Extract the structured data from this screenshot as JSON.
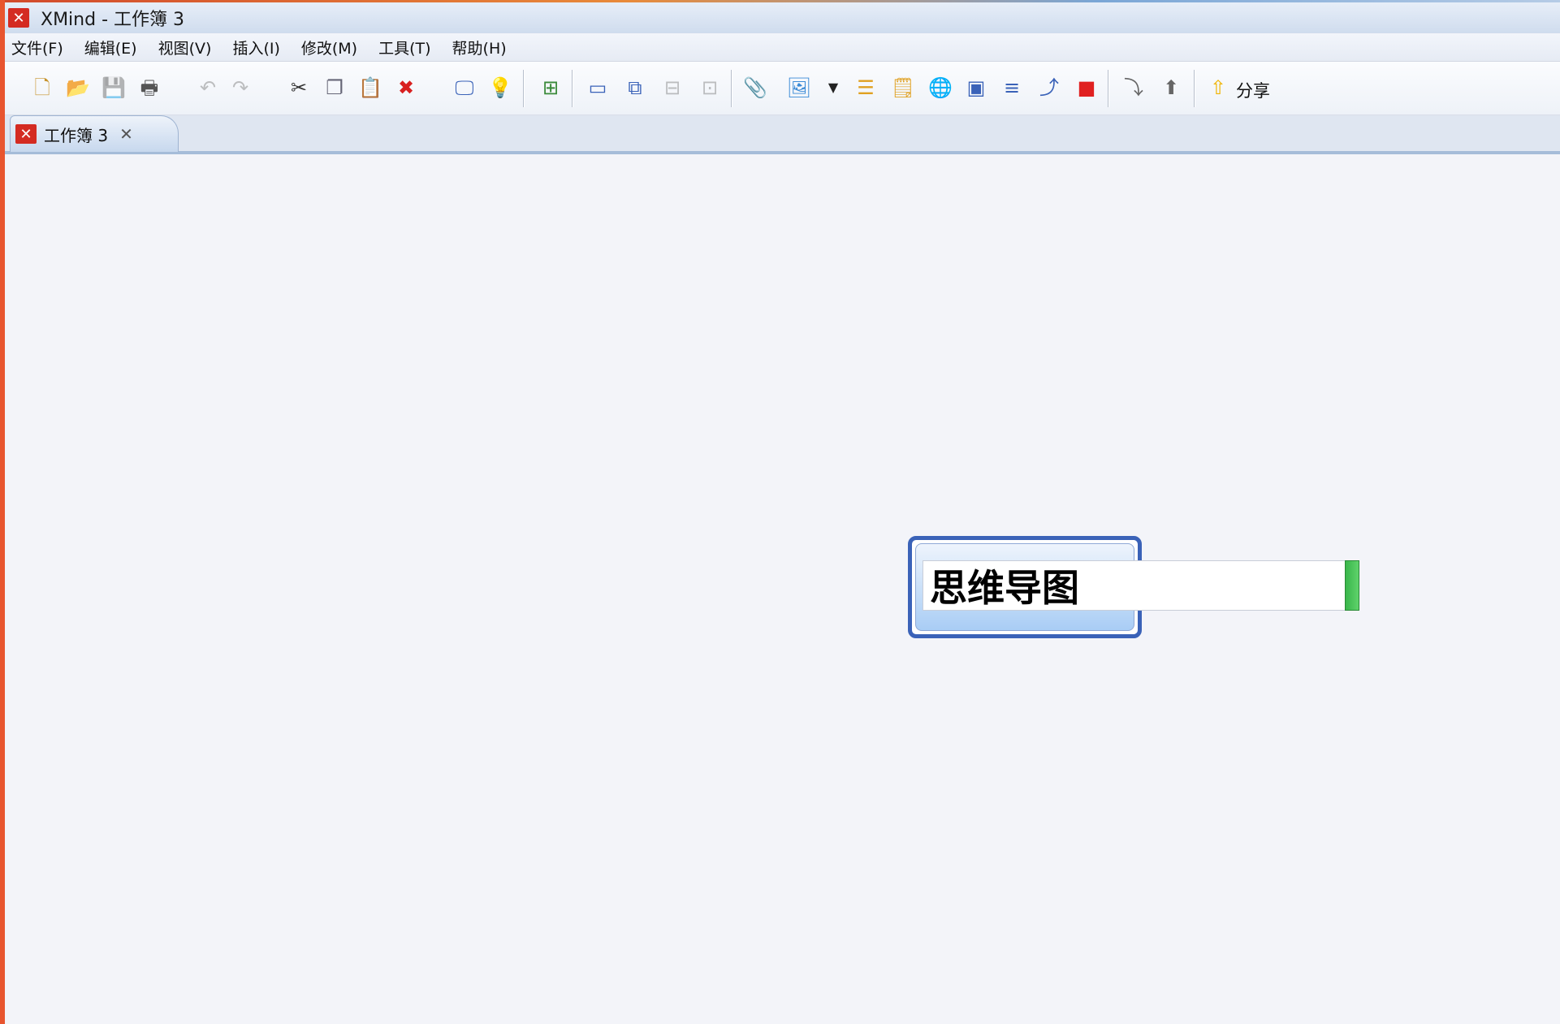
{
  "window": {
    "title": "XMind - 工作簿 3",
    "app_icon": "xmind-logo-icon",
    "accent_color": "#d42b22"
  },
  "menu": {
    "items": [
      {
        "label": "文件(F)"
      },
      {
        "label": "编辑(E)"
      },
      {
        "label": "视图(V)"
      },
      {
        "label": "插入(I)"
      },
      {
        "label": "修改(M)"
      },
      {
        "label": "工具(T)"
      },
      {
        "label": "帮助(H)"
      }
    ]
  },
  "toolbar": {
    "share_label": "分享",
    "icons": [
      "new-workbook-icon",
      "open-icon",
      "save-icon",
      "print-icon",
      "undo-icon",
      "redo-icon",
      "cut-icon",
      "copy-icon",
      "paste-icon",
      "delete-icon",
      "presentation-icon",
      "brainstorm-icon",
      "insert-icon",
      "topic-icon",
      "subtopic-icon",
      "callout-icon",
      "floating-topic-icon",
      "attachment-icon",
      "image-icon",
      "image-dropdown-icon",
      "summary-icon",
      "notes-icon",
      "hyperlink-icon",
      "boundary-icon",
      "summary-bracket-icon",
      "relationship-icon",
      "marker-icon",
      "drill-down-icon",
      "drill-up-icon",
      "share-icon"
    ]
  },
  "tab": {
    "label": "工作簿 3",
    "close_icon": "close-icon"
  },
  "canvas": {
    "central_topic": {
      "text": "思维导图",
      "border_color": "#3a62b8",
      "fill_color": "#a9cdf5"
    }
  }
}
